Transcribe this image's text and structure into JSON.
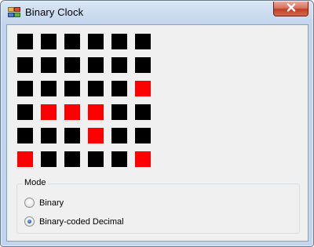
{
  "window": {
    "title": "Binary Clock",
    "close_glyph": "✕"
  },
  "icons": {
    "app": "app-icon",
    "close": "close-icon"
  },
  "colors": {
    "led_on": "#ff0000",
    "led_off": "#000000"
  },
  "clock": {
    "rows": 6,
    "cols": 6,
    "lit_cells": [
      [
        2,
        5
      ],
      [
        3,
        1
      ],
      [
        3,
        2
      ],
      [
        3,
        3
      ],
      [
        4,
        3
      ],
      [
        5,
        0
      ],
      [
        5,
        5
      ]
    ]
  },
  "mode": {
    "legend": "Mode",
    "options": [
      {
        "label": "Binary",
        "checked": false
      },
      {
        "label": "Binary-coded Decimal",
        "checked": true
      }
    ]
  }
}
